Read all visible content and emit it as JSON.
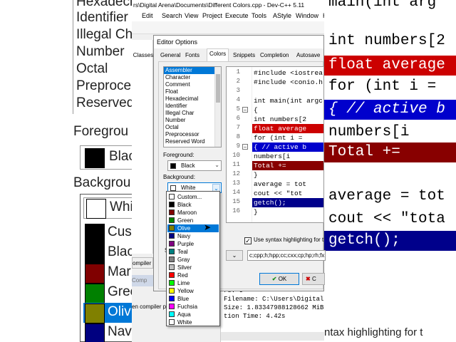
{
  "background_left": {
    "items": [
      "Hexadecimal",
      "Identifier",
      "Illegal Ch",
      "Number",
      "Octal",
      "Preproce",
      "Reserved"
    ],
    "foreground_label": "Foregrou",
    "foreground_value": "Blac",
    "background_label": "Backgrou",
    "background_value": "Whi",
    "colors": [
      {
        "label": "Cust",
        "color": "#000000"
      },
      {
        "label": "Blac",
        "color": "#000000"
      },
      {
        "label": "Mar",
        "color": "#800000"
      },
      {
        "label": "Gree",
        "color": "#008000"
      },
      {
        "label": "Oliv",
        "color": "#808000"
      },
      {
        "label": "Nav",
        "color": "#000080"
      }
    ]
  },
  "background_right": {
    "lines": [
      {
        "text": "main(int arg",
        "bg": "#ffffff",
        "color": "#000"
      },
      {
        "text": "int numbers[2",
        "bg": "#ffffff",
        "color": "#000"
      },
      {
        "text": "float average",
        "bg": "#cc0000",
        "color": "#ffffff"
      },
      {
        "text": "for (int i =",
        "bg": "#ffffff",
        "color": "#000"
      },
      {
        "text": "{ // active b",
        "bg": "#0000cc",
        "color": "#ffffff"
      },
      {
        "text": "  numbers[i",
        "bg": "#ffffff",
        "color": "#000"
      },
      {
        "text": "  Total +=",
        "bg": "#880000",
        "color": "#ffffff"
      },
      {
        "text": "average = tot",
        "bg": "#ffffff",
        "color": "#000"
      },
      {
        "text": "cout << \"tota",
        "bg": "#ffffff",
        "color": "#000"
      },
      {
        "text": "getch();",
        "bg": "#00008b",
        "color": "#ffffff"
      }
    ],
    "bottom_text": "ntax highlighting for t"
  },
  "ide": {
    "title": "rs\\Digital Arena\\Documents\\Different Colors.cpp - Dev-C++ 5.11",
    "menu": [
      "Edit",
      "Search",
      "View",
      "Project",
      "Execute",
      "Tools",
      "AStyle",
      "Window",
      "Help"
    ],
    "left_tab": "ompiler",
    "left_tab2": "Comp",
    "status_label": "en compiler pa",
    "output_lines": [
      "rs: 0",
      "Filename: C:\\Users\\Digital",
      "Size: 1.83347988128662 MiB",
      "tion Time: 4.42s"
    ]
  },
  "dialog": {
    "title": "Editor Options",
    "tabs": [
      "General",
      "Fonts",
      "Colors",
      "Snippets",
      "Completion",
      "Autosave"
    ],
    "active_tab": "Colors",
    "side_tab": "Classes",
    "elements": [
      "Assembler",
      "Character",
      "Comment",
      "Float",
      "Hexadecimal",
      "Identifier",
      "Illegal Char",
      "Number",
      "Octal",
      "Preprocessor",
      "Reserved Word"
    ],
    "selected_element": "Assembler",
    "foreground_label": "Foreground:",
    "foreground_value": "Black",
    "background_label": "Background:",
    "background_value": "White",
    "style_label": "S",
    "preview_lines": [
      {
        "n": "1",
        "text": "#include <iostrea",
        "bg": "",
        "color": "#000",
        "fold": ""
      },
      {
        "n": "2",
        "text": "#include <conio.h",
        "bg": "",
        "color": "#000",
        "fold": ""
      },
      {
        "n": "3",
        "text": "",
        "bg": "",
        "color": "#000",
        "fold": ""
      },
      {
        "n": "4",
        "text": "int main(int argc",
        "bg": "",
        "color": "#000",
        "fold": ""
      },
      {
        "n": "5",
        "text": "{",
        "bg": "",
        "color": "#000",
        "fold": "-"
      },
      {
        "n": "6",
        "text": "    int numbers[2",
        "bg": "",
        "color": "#000",
        "fold": ""
      },
      {
        "n": "7",
        "text": "    float average",
        "bg": "#cc0000",
        "color": "#ffffff",
        "fold": ""
      },
      {
        "n": "8",
        "text": "    for (int i =",
        "bg": "",
        "color": "#000",
        "fold": ""
      },
      {
        "n": "9",
        "text": "    { // active b",
        "bg": "#0000cc",
        "color": "#ffffff",
        "fold": "-"
      },
      {
        "n": "10",
        "text": "        numbers[i",
        "bg": "",
        "color": "#000",
        "fold": ""
      },
      {
        "n": "11",
        "text": "        Total +=",
        "bg": "#880000",
        "color": "#ffffff",
        "fold": ""
      },
      {
        "n": "12",
        "text": "    }",
        "bg": "",
        "color": "#000",
        "fold": ""
      },
      {
        "n": "13",
        "text": "    average = tot",
        "bg": "",
        "color": "#000",
        "fold": ""
      },
      {
        "n": "14",
        "text": "    cout << \"tot",
        "bg": "",
        "color": "#000",
        "fold": ""
      },
      {
        "n": "15",
        "text": "    getch();",
        "bg": "#00008b",
        "color": "#ffffff",
        "fold": ""
      },
      {
        "n": "16",
        "text": "}",
        "bg": "",
        "color": "#000",
        "fold": ""
      }
    ],
    "syntax_checkbox_label": "Use syntax highlighting for t",
    "syntax_checked": true,
    "extensions": "c;cpp;h;hpp;cc;cxx;cp;hp;rh;fx",
    "ok_label": "OK",
    "cancel_label": "C",
    "dropdown_options": [
      {
        "label": "Custom...",
        "color": "#ffffff"
      },
      {
        "label": "Black",
        "color": "#000000"
      },
      {
        "label": "Maroon",
        "color": "#800000"
      },
      {
        "label": "Green",
        "color": "#008000"
      },
      {
        "label": "Olive",
        "color": "#808000"
      },
      {
        "label": "Navy",
        "color": "#000080"
      },
      {
        "label": "Purple",
        "color": "#800080"
      },
      {
        "label": "Teal",
        "color": "#008080"
      },
      {
        "label": "Gray",
        "color": "#808080"
      },
      {
        "label": "Silver",
        "color": "#c0c0c0"
      },
      {
        "label": "Red",
        "color": "#ff0000"
      },
      {
        "label": "Lime",
        "color": "#00ff00"
      },
      {
        "label": "Yellow",
        "color": "#ffff00"
      },
      {
        "label": "Blue",
        "color": "#0000ff"
      },
      {
        "label": "Fuchsia",
        "color": "#ff00ff"
      },
      {
        "label": "Aqua",
        "color": "#00ffff"
      },
      {
        "label": "White",
        "color": "#ffffff"
      }
    ],
    "highlighted_option": "Olive",
    "selection_color": "#0078d7"
  }
}
